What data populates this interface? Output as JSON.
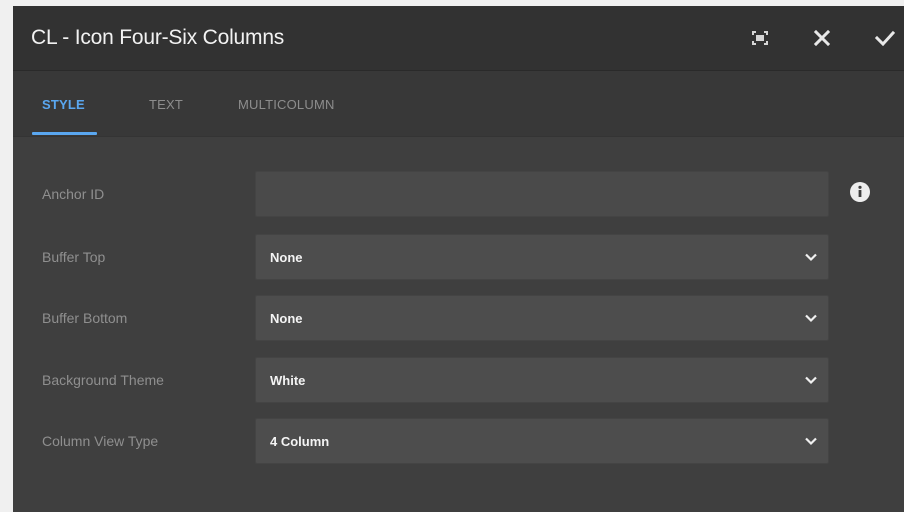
{
  "dialog": {
    "title": "CL - Icon Four-Six Columns",
    "actions": {
      "fullscreen": "fullscreen-icon",
      "close": "close-icon",
      "done": "check-icon"
    }
  },
  "tabs": [
    {
      "label": "STYLE",
      "active": true
    },
    {
      "label": "TEXT",
      "active": false
    },
    {
      "label": "MULTICOLUMN",
      "active": false
    }
  ],
  "form": {
    "anchor_id": {
      "label": "Anchor ID",
      "value": "",
      "info_icon": "info-icon"
    },
    "buffer_top": {
      "label": "Buffer Top",
      "value": "None"
    },
    "buffer_bottom": {
      "label": "Buffer Bottom",
      "value": "None"
    },
    "background_theme": {
      "label": "Background Theme",
      "value": "White"
    },
    "column_view_type": {
      "label": "Column View Type",
      "value": "4 Column"
    }
  },
  "colors": {
    "accent": "#5aa7f0",
    "dialog_bg": "#3f3f3f",
    "titlebar_bg": "#323232"
  }
}
